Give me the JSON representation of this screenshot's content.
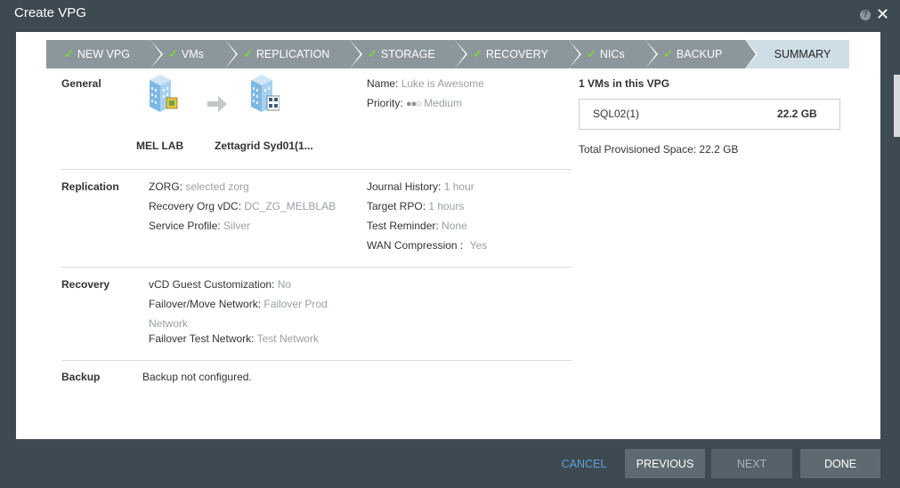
{
  "window": {
    "title": "Create VPG",
    "help_label": "?",
    "close_label": "✕"
  },
  "steps": [
    {
      "label": "NEW VPG",
      "done": true
    },
    {
      "label": "VMs",
      "done": true
    },
    {
      "label": "REPLICATION",
      "done": true
    },
    {
      "label": "STORAGE",
      "done": true
    },
    {
      "label": "RECOVERY",
      "done": true
    },
    {
      "label": "NICs",
      "done": true
    },
    {
      "label": "BACKUP",
      "done": true
    },
    {
      "label": "SUMMARY",
      "done": false
    }
  ],
  "check_glyph": "✓",
  "general": {
    "heading": "General",
    "source_site": "MEL LAB",
    "target_site": "Zettagrid Syd01(1...",
    "name_label": "Name:",
    "name_value": "Luke is Awesome",
    "priority_label": "Priority:",
    "priority_dots": "●●○",
    "priority_value": "Medium"
  },
  "replication": {
    "heading": "Replication",
    "zorg_label": "ZORG:",
    "zorg_value": "selected zorg",
    "recovery_org_label": "Recovery Org vDC:",
    "recovery_org_value": "DC_ZG_MELBLAB",
    "service_profile_label": "Service Profile:",
    "service_profile_value": "Silver",
    "journal_label": "Journal History:",
    "journal_value": "1 hour",
    "rpo_label": "Target RPO:",
    "rpo_value": "1 hours",
    "test_reminder_label": "Test Reminder:",
    "test_reminder_value": "None",
    "wan_label": "WAN Compression :",
    "wan_value": "Yes"
  },
  "recovery": {
    "heading": "Recovery",
    "guest_label": "vCD Guest Customization:",
    "guest_value": "No",
    "failover_label": "Failover/Move Network:",
    "failover_value_1": "Failover Prod",
    "failover_value_2": "Network",
    "test_net_label": "Failover Test Network:",
    "test_net_value": "Test Network"
  },
  "backup": {
    "heading": "Backup",
    "value": "Backup not configured."
  },
  "vms": {
    "heading": "1 VMs in this VPG",
    "items": [
      {
        "name": "SQL02(1)",
        "size": "22.2 GB"
      }
    ],
    "total_label": "Total Provisioned Space: 22.2 GB"
  },
  "footer": {
    "cancel": "CANCEL",
    "previous": "PREVIOUS",
    "next": "NEXT",
    "done": "DONE"
  },
  "colors": {
    "accent": "#5fa3d8",
    "check": "#7fd43b",
    "step_bg": "#8c979d",
    "step_active_bg": "#cfdde7",
    "frame": "#3e4a52"
  }
}
